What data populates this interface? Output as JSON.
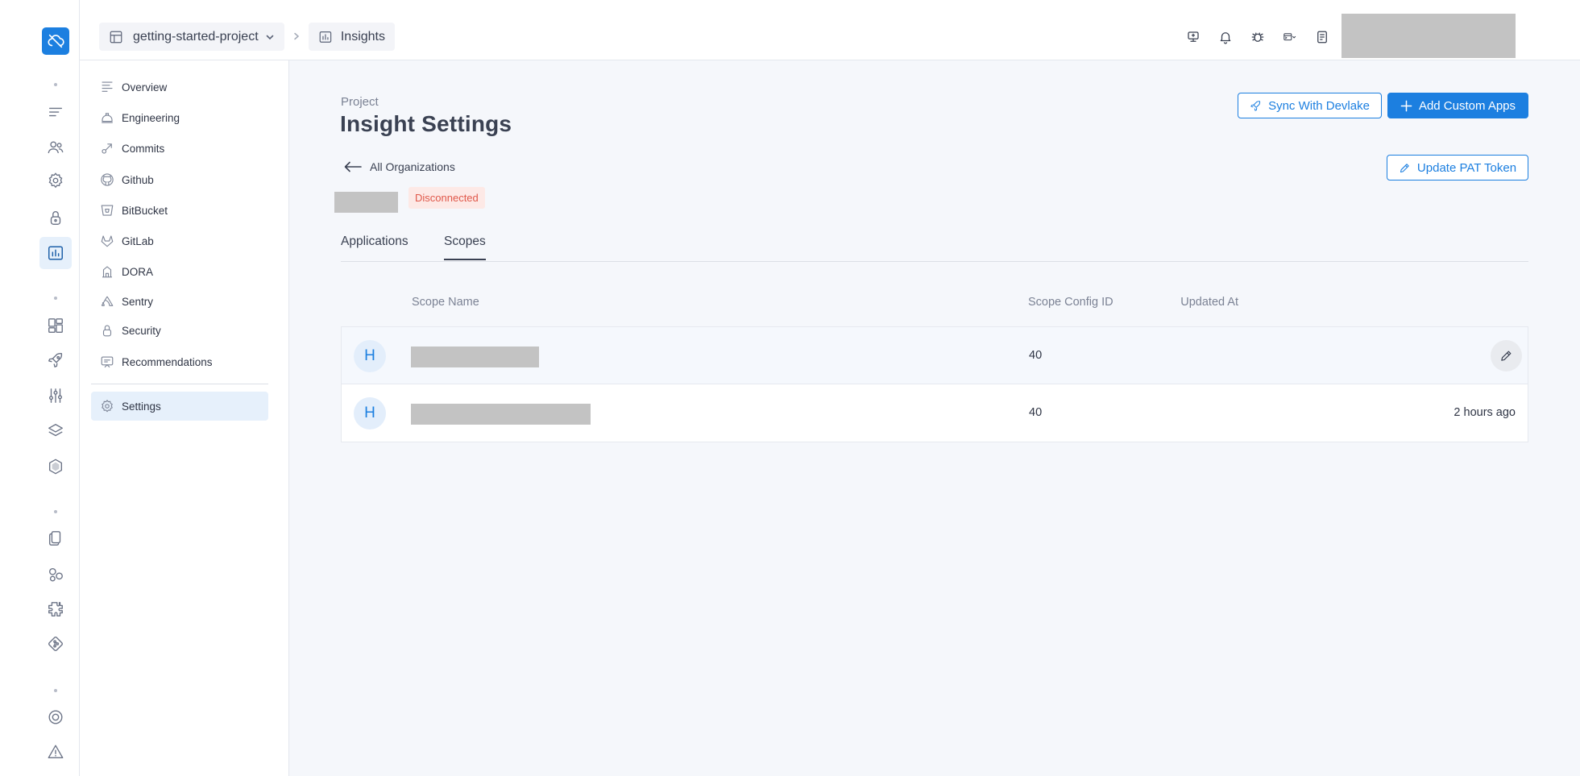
{
  "header": {
    "project_name": "getting-started-project",
    "current_section": "Insights",
    "icons": [
      "desktop-icon",
      "bell-icon",
      "bug-icon",
      "browser-dropdown-icon",
      "document-icon"
    ]
  },
  "rail": {
    "active": "insights-icon",
    "icons": [
      "list-icon",
      "users-icon",
      "settings-icon",
      "lock-icon",
      "chart-icon",
      "widgets-icon",
      "rocket-icon",
      "sliders-icon",
      "layers-icon",
      "shield-icon",
      "docs-icon",
      "shapes-icon",
      "puzzle-icon",
      "git-diamond-icon",
      "target-icon",
      "warning-icon"
    ]
  },
  "sidebar": {
    "items": [
      {
        "label": "Overview",
        "icon": "overview-icon"
      },
      {
        "label": "Engineering",
        "icon": "engineering-icon"
      },
      {
        "label": "Commits",
        "icon": "commits-icon"
      },
      {
        "label": "Github",
        "icon": "github-icon"
      },
      {
        "label": "BitBucket",
        "icon": "bitbucket-icon"
      },
      {
        "label": "GitLab",
        "icon": "gitlab-icon"
      },
      {
        "label": "DORA",
        "icon": "dora-icon"
      },
      {
        "label": "Sentry",
        "icon": "sentry-icon"
      },
      {
        "label": "Security",
        "icon": "security-icon"
      },
      {
        "label": "Recommendations",
        "icon": "recommendations-icon"
      }
    ],
    "settings_label": "Settings"
  },
  "main": {
    "eyebrow": "Project",
    "title": "Insight Settings",
    "back_label": "All Organizations",
    "status": "Disconnected",
    "buttons": {
      "sync": "Sync With Devlake",
      "add": "Add Custom Apps",
      "pat": "Update PAT Token"
    },
    "tabs": [
      {
        "label": "Applications",
        "active": false
      },
      {
        "label": "Scopes",
        "active": true
      }
    ],
    "table": {
      "columns": [
        "Scope Name",
        "Scope Config ID",
        "Updated At"
      ],
      "rows": [
        {
          "avatar": "H",
          "config_id": "40",
          "updated_at": ""
        },
        {
          "avatar": "H",
          "config_id": "40",
          "updated_at": "2 hours ago"
        }
      ]
    }
  },
  "colors": {
    "accent": "#1c7fe0",
    "danger": "#e0584a",
    "danger_bg": "#fde9e6",
    "active_bg": "#e6f0fb"
  }
}
